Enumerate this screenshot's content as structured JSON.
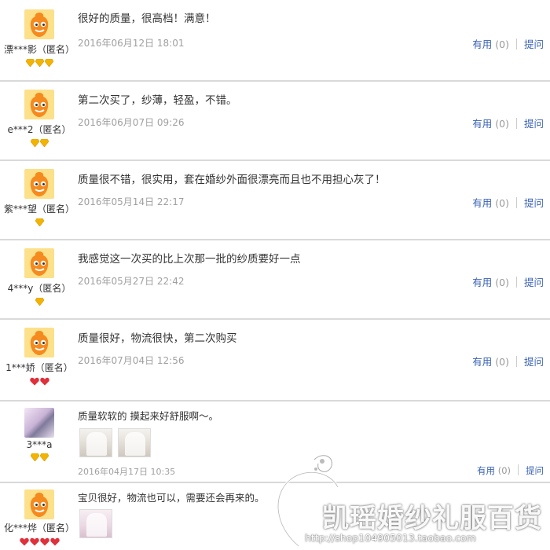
{
  "reviews": [
    {
      "nick": "漂***影（匿名）",
      "content": "很好的质量，很高档！满意！",
      "date": "2016年06月12日 18:01",
      "badge_type": "gold-diamond",
      "badge_count": 3,
      "useful_label": "有用",
      "useful_count": "(0)",
      "ask_label": "提问"
    },
    {
      "nick": "e***2（匿名）",
      "content": "第二次买了，纱薄，轻盈，不错。",
      "date": "2016年06月07日 09:26",
      "badge_type": "gold-diamond",
      "badge_count": 2,
      "useful_label": "有用",
      "useful_count": "(0)",
      "ask_label": "提问"
    },
    {
      "nick": "紫***望（匿名）",
      "content": "质量很不错，很实用，套在婚纱外面很漂亮而且也不用担心灰了！",
      "date": "2016年05月14日 22:17",
      "badge_type": "gold-diamond",
      "badge_count": 1,
      "useful_label": "有用",
      "useful_count": "(0)",
      "ask_label": "提问"
    },
    {
      "nick": "4***y（匿名）",
      "content": "我感觉这一次买的比上次那一批的纱质要好一点",
      "date": "2016年05月27日 22:42",
      "badge_type": "gold-diamond",
      "badge_count": 1,
      "useful_label": "有用",
      "useful_count": "(0)",
      "ask_label": "提问"
    },
    {
      "nick": "1***娇（匿名）",
      "content": "质量很好，物流很快，第二次购买",
      "date": "2016年07月04日 12:56",
      "badge_type": "red-heart",
      "badge_count": 2,
      "useful_label": "有用",
      "useful_count": "(0)",
      "ask_label": "提问"
    },
    {
      "nick": "3***a",
      "content": "质量软软的 摸起来好舒服啊～。",
      "date": "2016年04月17日 10:35",
      "badge_type": "gold-diamond",
      "badge_count": 2,
      "useful_label": "有用",
      "useful_count": "(0)",
      "ask_label": "提问",
      "photo_count": 2
    },
    {
      "nick": "化***烨（匿名）",
      "content": "宝贝很好，物流也可以，需要还会再来的。",
      "date": "",
      "badge_type": "red-heart",
      "badge_count": 4,
      "useful_label": "",
      "useful_count": "",
      "ask_label": "",
      "photo_count": 1
    }
  ],
  "watermark": {
    "title": "凯瑶婚纱礼服百货",
    "url": "http://shop104905013.taobao.com"
  },
  "colors": {
    "link": "#3a62b4",
    "date": "#a0a0a0",
    "divider": "#d9d9d9",
    "avatar": "#f5a623",
    "avatar_bg": "#fce08a",
    "gold_badge": "#f2b400",
    "red_badge": "#e0303a"
  }
}
